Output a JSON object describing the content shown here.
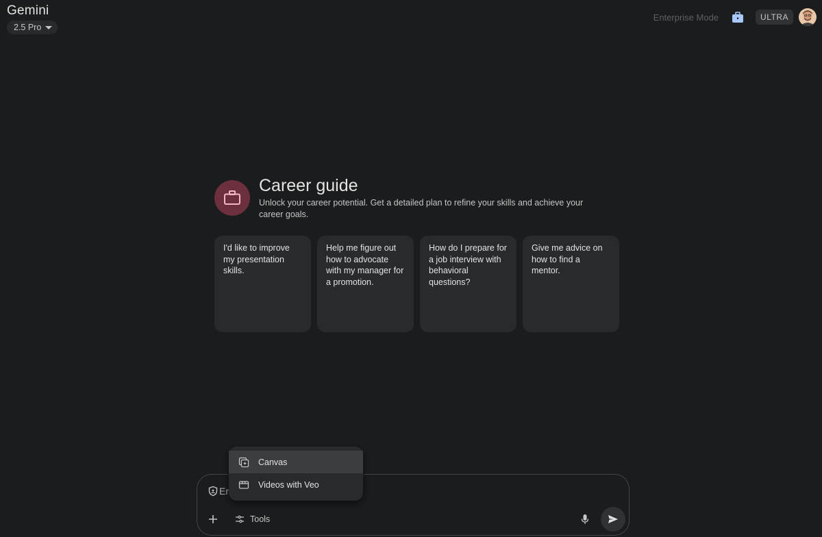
{
  "header": {
    "app_title": "Gemini",
    "model_label": "2.5 Pro",
    "enterprise_mode": "Enterprise Mode",
    "plan_badge": "ULTRA"
  },
  "gem": {
    "icon": "briefcase-icon",
    "title": "Career guide",
    "description": "Unlock your career potential. Get a detailed plan to refine your skills and achieve your career goals."
  },
  "suggestions": [
    "I'd like to improve my presentation skills.",
    "Help me figure out how to advocate with my manager for a promotion.",
    "How do I prepare for a job interview with behavioral questions?",
    "Give me advice on how to find a mentor."
  ],
  "tools_menu": {
    "items": [
      {
        "label": "Canvas",
        "icon": "canvas-icon",
        "highlighted": true
      },
      {
        "label": "Videos with Veo",
        "icon": "video-icon",
        "highlighted": false
      }
    ]
  },
  "prompt": {
    "placeholder": "Enter a prompt here",
    "tools_label": "Tools"
  },
  "colors": {
    "background": "#1b1c1d",
    "card": "#282a2c",
    "gem_icon_bg": "#6b2f3d",
    "accent_blue": "#a8c7fa"
  }
}
